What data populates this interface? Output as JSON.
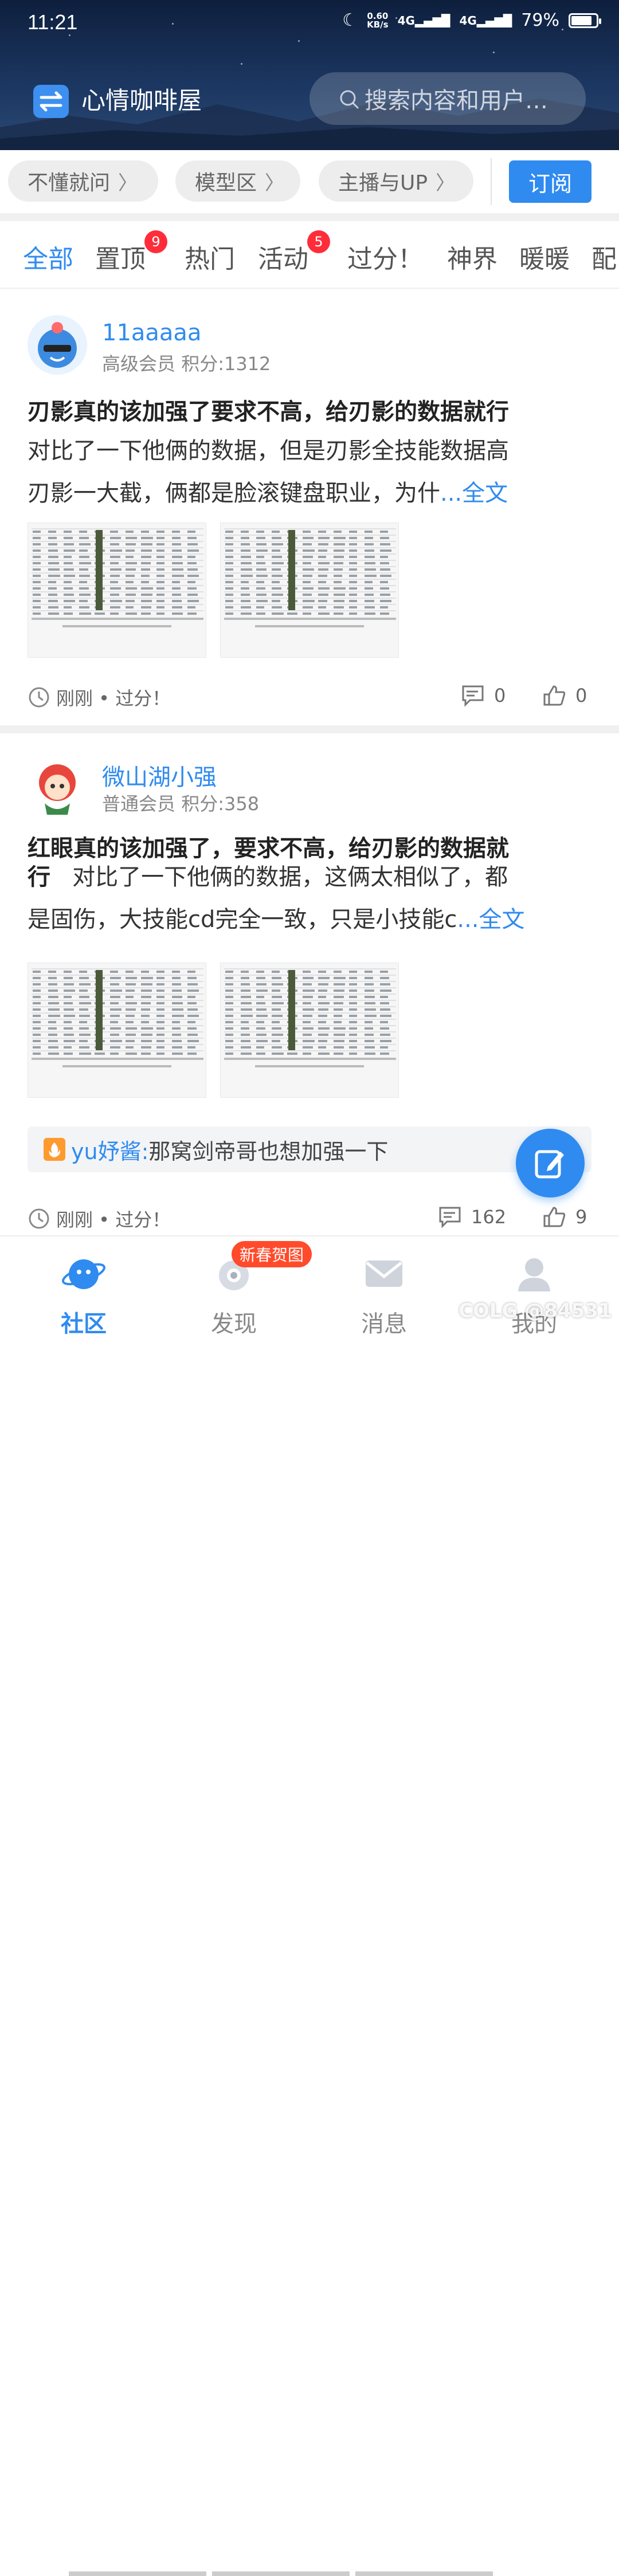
{
  "status_bar": {
    "time": "11:21",
    "net_speed_value": "0.60",
    "net_speed_unit": "KB/s",
    "sig1": "4G",
    "sig2": "4G",
    "battery": "79%",
    "battery_level": 0.79
  },
  "header": {
    "title": "心情咖啡屋",
    "search_placeholder": "搜索内容和用户…"
  },
  "chips": [
    "不懂就问",
    "模型区",
    "主播与UP"
  ],
  "subscribe_label": "订阅",
  "tabs": [
    {
      "label": "全部"
    },
    {
      "label": "置顶",
      "badge": "9"
    },
    {
      "label": "热门"
    },
    {
      "label": "活动",
      "badge": "5"
    },
    {
      "label": "过分！"
    },
    {
      "label": "神界"
    },
    {
      "label": "暖暖"
    },
    {
      "label": "配"
    }
  ],
  "posts": [
    {
      "username": "11aaaaa",
      "level": "高级会员",
      "points": "积分:1312",
      "title": "刃影真的该加强了要求不高，给刃影的数据就行",
      "body_line1": "对比了一下他俩的数据，但是刃影全技能数据高",
      "body_line2": "刃影一大截，俩都是脸滚键盘职业，为什",
      "more": "...全文",
      "time_tag": "刚刚 • 过分！",
      "comments": "0",
      "likes": "0"
    },
    {
      "username": "微山湖小强",
      "level": "普通会员",
      "points": "积分:358",
      "title_line1": "红眼真的该加强了，要求不高，给刃影的数据就",
      "title_line2": "行",
      "body_line1": "对比了一下他俩的数据，这俩太相似了，都",
      "body_line2": "是固伤，大技能cd完全一致，只是小技能c",
      "more": "...全文",
      "comment_preview": {
        "name": "yu妤酱:",
        "text": "那窝剑帝哥也想加强一下"
      },
      "time_tag": "刚刚 • 过分！",
      "comments": "162",
      "likes": "9"
    }
  ],
  "bottom_nav": {
    "items": [
      "社区",
      "发现",
      "消息",
      "我的"
    ],
    "promo": "新春贺图"
  },
  "watermark": "COLG @84531",
  "colors": {
    "accent": "#2f8bef",
    "badge": "#ff2d3a",
    "promo": "#ff4b2b"
  }
}
